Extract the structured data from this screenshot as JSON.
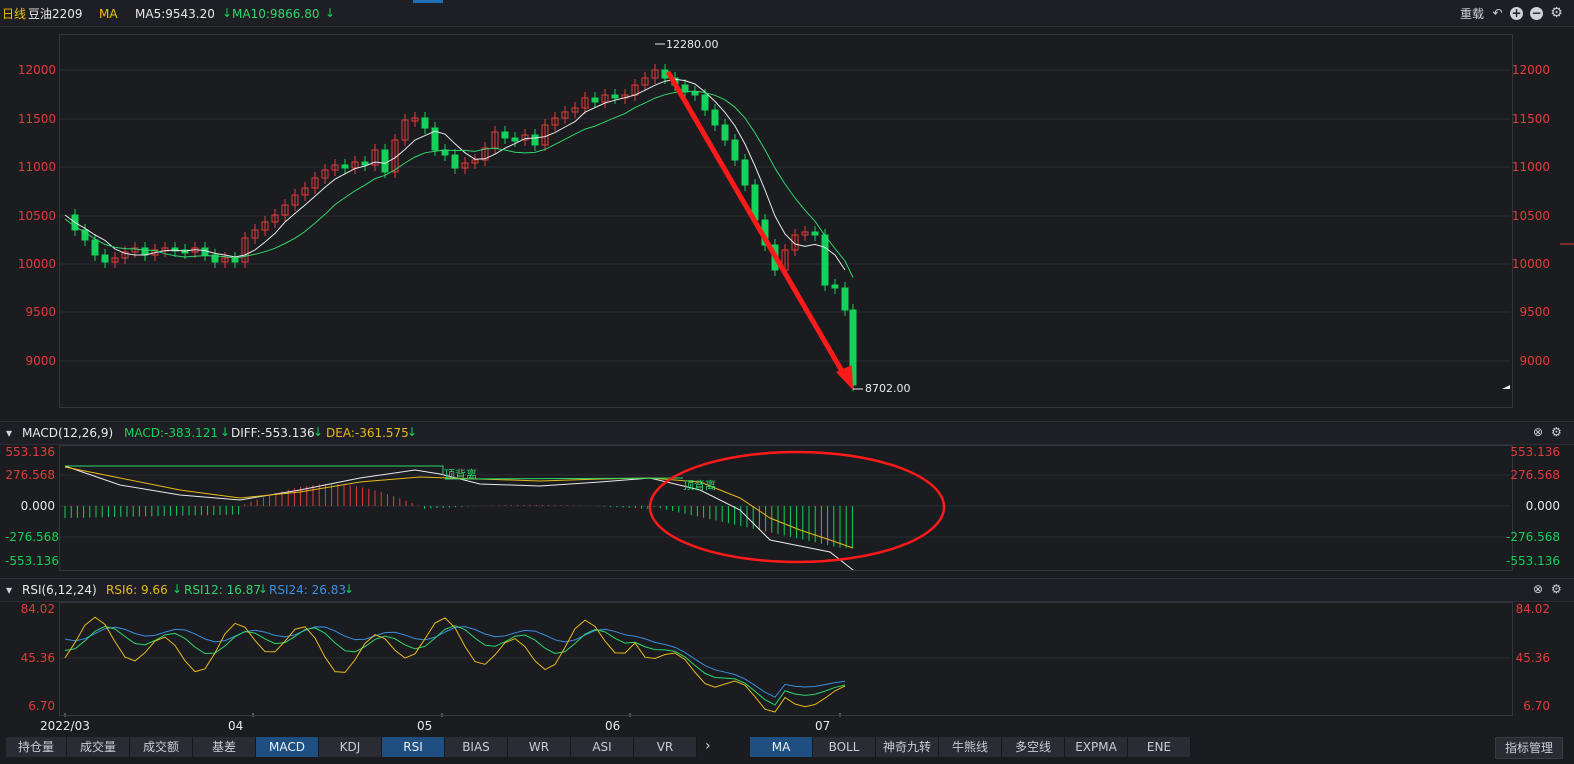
{
  "header": {
    "period": "日线",
    "symbol": "豆油2209",
    "indicator": "MA",
    "ma5": "MA5:9543.20",
    "ma10": "MA10:9866.80",
    "reload": "重载"
  },
  "price_axis": {
    "left": [
      "12000",
      "11500",
      "11000",
      "10500",
      "10000",
      "9500",
      "9000"
    ],
    "right": [
      "12000",
      "11500",
      "11000",
      "10500",
      "10000",
      "9500",
      "9000"
    ]
  },
  "annotations": {
    "high": "12280.00",
    "low": "8702.00"
  },
  "macd": {
    "title": "MACD(12,26,9)",
    "macd": "MACD:-383.121",
    "diff": "DIFF:-553.136",
    "dea": "DEA:-361.575",
    "axis": [
      "553.136",
      "276.568",
      "0.000",
      "-276.568",
      "-553.136"
    ],
    "divergence_labels": [
      "顶背离",
      "顶背离"
    ]
  },
  "rsi": {
    "title": "RSI(6,12,24)",
    "rsi6": "RSI6: 9.66",
    "rsi12": "RSI12: 16.87",
    "rsi24": "RSI24: 26.83",
    "axis": [
      "84.02",
      "45.36",
      "6.70"
    ]
  },
  "time_axis": [
    "2022/03",
    "04",
    "05",
    "06",
    "07"
  ],
  "bottom_tabs": {
    "left": [
      "持仓量",
      "成交量",
      "成交额",
      "基差",
      "MACD",
      "KDJ",
      "RSI",
      "BIAS",
      "WR",
      "ASI",
      "VR"
    ],
    "right": [
      "MA",
      "BOLL",
      "神奇九转",
      "牛熊线",
      "多空线",
      "EXPMA",
      "ENE"
    ],
    "manage": "指标管理"
  },
  "colors": {
    "up": "#e23b3b",
    "down": "#14d15a",
    "ma5": "#e9e9e9",
    "ma10": "#2fd56b",
    "dea": "#e8b81a",
    "rsi6": "#e8b81a",
    "rsi12": "#2fd56b",
    "rsi24": "#3a8fe0",
    "arrow": "#ff1a1a",
    "active_tab": "#1f4f80"
  }
}
